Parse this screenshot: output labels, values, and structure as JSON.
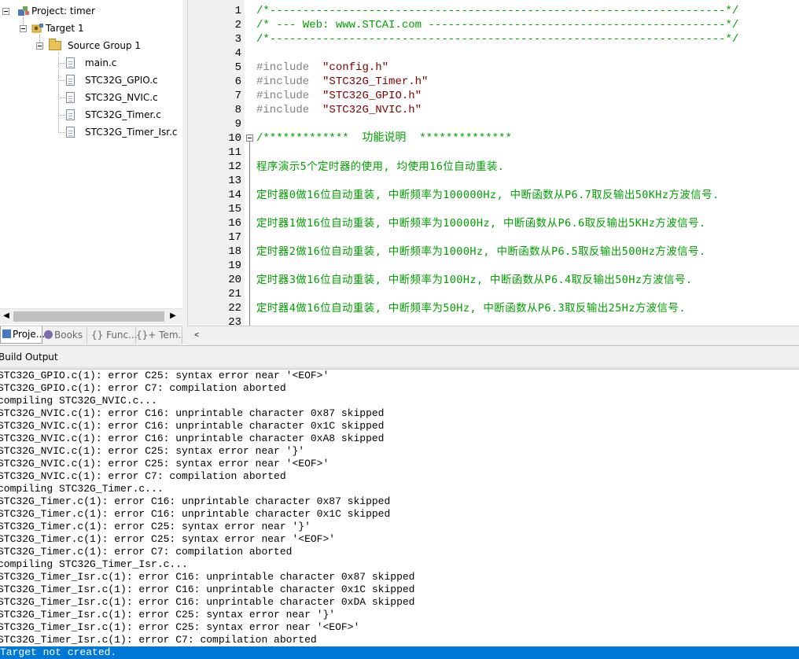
{
  "project_tree": {
    "project_label": "Project: timer",
    "target_label": "Target 1",
    "group_label": "Source Group 1",
    "files": [
      "main.c",
      "STC32G_GPIO.c",
      "STC32G_NVIC.c",
      "STC32G_Timer.c",
      "STC32G_Timer_Isr.c"
    ]
  },
  "panel_tabs": [
    "Proje...",
    "Books",
    "{} Func...",
    "{}+ Tem..."
  ],
  "editor": {
    "line_numbers": [
      "1",
      "2",
      "3",
      "4",
      "5",
      "6",
      "7",
      "8",
      "9",
      "10",
      "11",
      "12",
      "13",
      "14",
      "15",
      "16",
      "17",
      "18",
      "19",
      "20",
      "21",
      "22",
      "23"
    ],
    "lines": {
      "l1": "/*---------------------------------------------------------------------*/",
      "l2": "/* --- Web: www.STCAI.com ---------------------------------------------*/",
      "l3": "/*---------------------------------------------------------------------*/",
      "l5_dir": "#include",
      "l5_file": "\"config.h\"",
      "l6_dir": "#include",
      "l6_file": "\"STC32G_Timer.h\"",
      "l7_dir": "#include",
      "l7_file": "\"STC32G_GPIO.h\"",
      "l8_dir": "#include",
      "l8_file": "\"STC32G_NVIC.h\"",
      "l10": "/*************  功能说明  **************",
      "l12": "程序演示5个定时器的使用, 均使用16位自动重装.",
      "l14": "定时器0做16位自动重装, 中断频率为100000Hz, 中断函数从P6.7取反输出50KHz方波信号.",
      "l16": "定时器1做16位自动重装, 中断频率为10000Hz, 中断函数从P6.6取反输出5KHz方波信号.",
      "l18": "定时器2做16位自动重装, 中断频率为1000Hz, 中断函数从P6.5取反输出500Hz方波信号.",
      "l20": "定时器3做16位自动重装, 中断频率为100Hz, 中断函数从P6.4取反输出50Hz方波信号.",
      "l22": "定时器4做16位自动重装, 中断频率为50Hz, 中断函数从P6.3取反输出25Hz方波信号."
    }
  },
  "build_output": {
    "title": "Build Output",
    "lines": [
      "STC32G_GPIO.c(1): error C25: syntax error near '<EOF>'",
      "STC32G_GPIO.c(1): error C7: compilation aborted",
      "compiling STC32G_NVIC.c...",
      "STC32G_NVIC.c(1): error C16: unprintable character 0x87 skipped",
      "STC32G_NVIC.c(1): error C16: unprintable character 0x1C skipped",
      "STC32G_NVIC.c(1): error C16: unprintable character 0xA8 skipped",
      "STC32G_NVIC.c(1): error C25: syntax error near '}'",
      "STC32G_NVIC.c(1): error C25: syntax error near '<EOF>'",
      "STC32G_NVIC.c(1): error C7: compilation aborted",
      "compiling STC32G_Timer.c...",
      "STC32G_Timer.c(1): error C16: unprintable character 0x87 skipped",
      "STC32G_Timer.c(1): error C16: unprintable character 0x1C skipped",
      "STC32G_Timer.c(1): error C25: syntax error near '}'",
      "STC32G_Timer.c(1): error C25: syntax error near '<EOF>'",
      "STC32G_Timer.c(1): error C7: compilation aborted",
      "compiling STC32G_Timer_Isr.c...",
      "STC32G_Timer_Isr.c(1): error C16: unprintable character 0x87 skipped",
      "STC32G_Timer_Isr.c(1): error C16: unprintable character 0x1C skipped",
      "STC32G_Timer_Isr.c(1): error C16: unprintable character 0xDA skipped",
      "STC32G_Timer_Isr.c(1): error C25: syntax error near '}'",
      "STC32G_Timer_Isr.c(1): error C25: syntax error near '<EOF>'",
      "STC32G_Timer_Isr.c(1): error C7: compilation aborted",
      "Target not created."
    ]
  },
  "colors": {
    "comment": "#00a000",
    "preprocessor": "#808080",
    "string": "#800000",
    "selection": "#0078d7"
  }
}
